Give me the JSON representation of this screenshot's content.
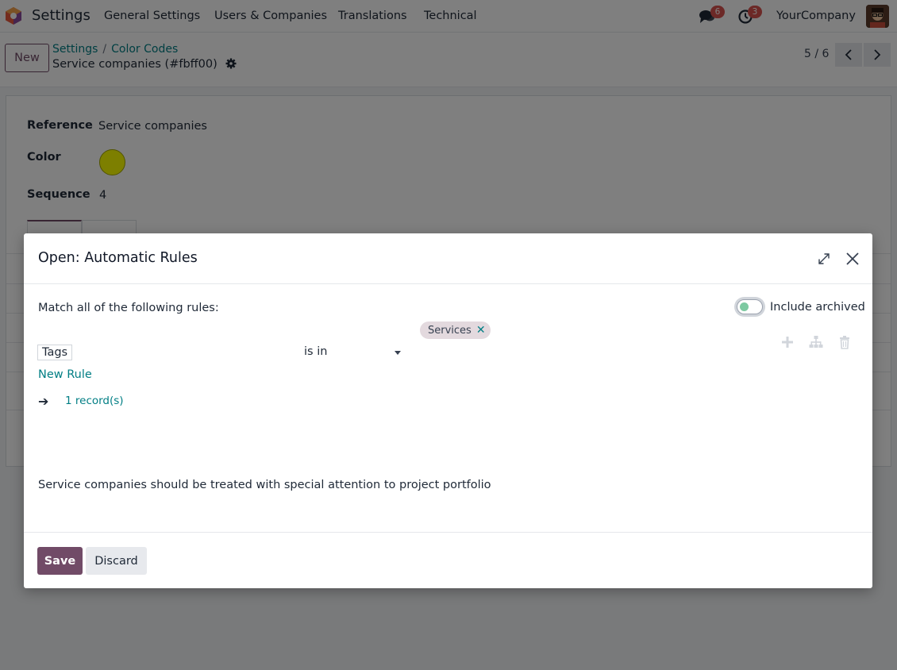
{
  "navbar": {
    "app_name": "Settings",
    "menu": [
      "General Settings",
      "Users & Companies",
      "Translations",
      "Technical"
    ],
    "messages_badge": "6",
    "activities_badge": "3",
    "company": "YourCompany",
    "icons": [
      "app-logo-icon",
      "chat-icon",
      "clock-icon",
      "avatar"
    ]
  },
  "control": {
    "new_label": "New",
    "breadcrumb": [
      "Settings",
      "Color Codes"
    ],
    "breadcrumb_sep": "/",
    "record_title": "Service companies (#fbff00)",
    "pager": "5 / 6"
  },
  "form": {
    "reference_label": "Reference",
    "reference_value": "Service companies",
    "color_label": "Color",
    "color_value": "#fbff00",
    "sequence_label": "Sequence",
    "sequence_value": "4"
  },
  "dialog": {
    "title": "Open: Automatic Rules",
    "match_text": "Match all of the following rules:",
    "include_archived_label": "Include archived",
    "include_archived_on": false,
    "rule": {
      "field": "Tags",
      "operator": "is in",
      "values": [
        "Services"
      ]
    },
    "new_rule_label": "New Rule",
    "records_arrow": "➔",
    "records_link": "1 record(s)",
    "note": "Service companies should be treated with special attention to project portfolio",
    "save_label": "Save",
    "discard_label": "Discard"
  },
  "colors": {
    "brand": "#714b67",
    "link": "#017e84",
    "badge": "#d9534f",
    "record_color": "#fbff00"
  }
}
